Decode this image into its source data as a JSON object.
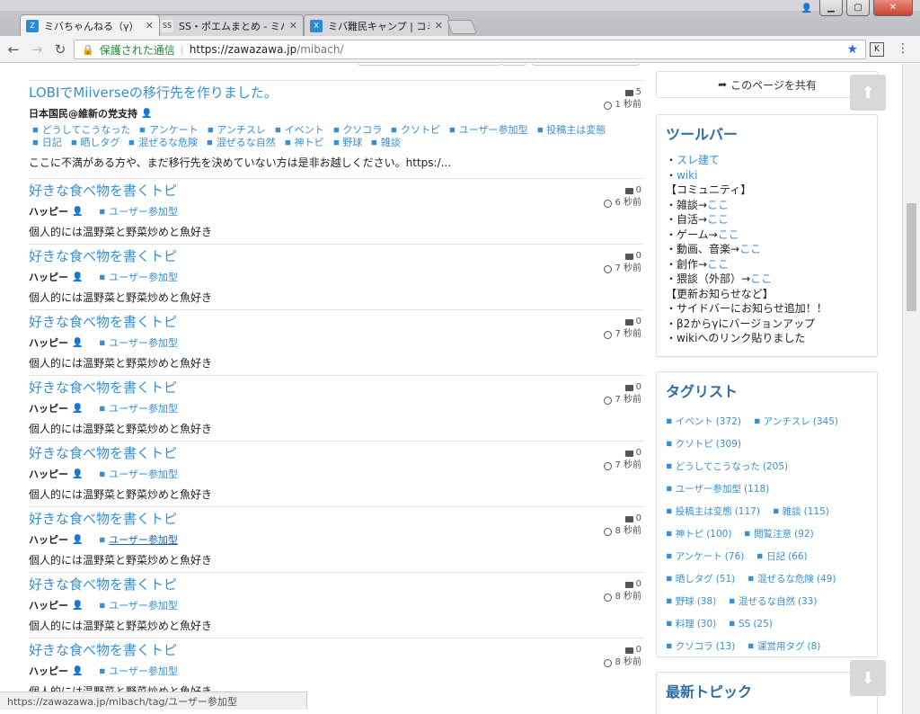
{
  "browser": {
    "tabs": [
      {
        "title": "ミバちゃんねる（γ） - ミ",
        "active": true,
        "favicon": "Z"
      },
      {
        "title": "SS・ポエムまとめ - ミバ",
        "active": false,
        "favicon": "SS"
      },
      {
        "title": "ミバ難民キャンプ | コミ",
        "active": false,
        "favicon": "X"
      }
    ],
    "secure_label": "保護された通信",
    "url_host": "https://zawazawa.jp",
    "url_path": "/mibach/",
    "ext_label": "K"
  },
  "main": {
    "topics": [
      {
        "title": "LOBIでMiiverseの移行先を作りました。",
        "author": "日本国民@維新の党支持",
        "tags": [
          "どうしてこうなった",
          "アンケート",
          "アンチスレ",
          "イベント",
          "クソコラ",
          "クソトピ",
          "ユーザー参加型",
          "投稿主は変態",
          "日記",
          "晒しタグ",
          "混ぜるな危険",
          "混ぜるな自然",
          "神トピ",
          "野球",
          "雑談"
        ],
        "excerpt": "ここに不満がある方や、まだ移行先を決めていない方は是非お越しください。https:/...",
        "comments": "5",
        "time": "1 秒前"
      },
      {
        "title": "好きな食べ物を書くトピ",
        "author": "ハッピー",
        "tags": [
          "ユーザー参加型"
        ],
        "excerpt": "個人的には温野菜と野菜炒めと魚好き",
        "comments": "0",
        "time": "6 秒前"
      },
      {
        "title": "好きな食べ物を書くトピ",
        "author": "ハッピー",
        "tags": [
          "ユーザー参加型"
        ],
        "excerpt": "個人的には温野菜と野菜炒めと魚好き",
        "comments": "0",
        "time": "7 秒前"
      },
      {
        "title": "好きな食べ物を書くトピ",
        "author": "ハッピー",
        "tags": [
          "ユーザー参加型"
        ],
        "excerpt": "個人的には温野菜と野菜炒めと魚好き",
        "comments": "0",
        "time": "7 秒前"
      },
      {
        "title": "好きな食べ物を書くトピ",
        "author": "ハッピー",
        "tags": [
          "ユーザー参加型"
        ],
        "excerpt": "個人的には温野菜と野菜炒めと魚好き",
        "comments": "0",
        "time": "7 秒前"
      },
      {
        "title": "好きな食べ物を書くトピ",
        "author": "ハッピー",
        "tags": [
          "ユーザー参加型"
        ],
        "excerpt": "個人的には温野菜と野菜炒めと魚好き",
        "comments": "0",
        "time": "7 秒前"
      },
      {
        "title": "好きな食べ物を書くトピ",
        "author": "ハッピー",
        "tags": [
          "ユーザー参加型"
        ],
        "excerpt": "個人的には温野菜と野菜炒めと魚好き",
        "comments": "0",
        "time": "8 秒前",
        "hover_tag": true
      },
      {
        "title": "好きな食べ物を書くトピ",
        "author": "ハッピー",
        "tags": [
          "ユーザー参加型"
        ],
        "excerpt": "個人的には温野菜と野菜炒めと魚好き",
        "comments": "0",
        "time": "8 秒前"
      },
      {
        "title": "好きな食べ物を書くトピ",
        "author": "ハッピー",
        "tags": [
          "ユーザー参加型"
        ],
        "excerpt": "個人的には温野菜と野菜炒めと魚好き",
        "comments": "0",
        "time": "8 秒前"
      }
    ],
    "status_url": "https://zawazawa.jp/mibach/tag/ユーザー参加型"
  },
  "sidebar": {
    "share_label": "このページを共有",
    "toolbar_title": "ツールバー",
    "toolbar_lines": [
      {
        "pre": "・",
        "link": "スレ建て",
        "post": ""
      },
      {
        "pre": "・",
        "link": "wiki",
        "post": ""
      },
      {
        "pre": "【コミュニティ】",
        "link": "",
        "post": ""
      },
      {
        "pre": "・雑談→",
        "link": "ここ",
        "post": ""
      },
      {
        "pre": "・自活→",
        "link": "ここ",
        "post": ""
      },
      {
        "pre": "・ゲーム→",
        "link": "ここ",
        "post": ""
      },
      {
        "pre": "・動画、音楽→",
        "link": "ここ",
        "post": ""
      },
      {
        "pre": "・創作→",
        "link": "ここ",
        "post": ""
      },
      {
        "pre": "・猥談（外部）→",
        "link": "ここ",
        "post": ""
      },
      {
        "pre": "【更新お知らせなど】",
        "link": "",
        "post": ""
      },
      {
        "pre": "・サイドバーにお知らせ追加！！",
        "link": "",
        "post": ""
      },
      {
        "pre": "・β2からγにバージョンアップ",
        "link": "",
        "post": ""
      },
      {
        "pre": "・wikiへのリンク貼りました",
        "link": "",
        "post": ""
      }
    ],
    "taglist_title": "タグリスト",
    "taglist_rows": [
      [
        {
          "name": "イベント",
          "count": "(372)"
        },
        {
          "name": "アンチスレ",
          "count": "(345)"
        }
      ],
      [
        {
          "name": "クソトピ",
          "count": "(309)"
        }
      ],
      [
        {
          "name": "どうしてこうなった",
          "count": "(205)"
        }
      ],
      [
        {
          "name": "ユーザー参加型",
          "count": "(118)"
        }
      ],
      [
        {
          "name": "投稿主は変態",
          "count": "(117)"
        },
        {
          "name": "雑談",
          "count": "(115)"
        }
      ],
      [
        {
          "name": "神トピ",
          "count": "(100)"
        },
        {
          "name": "閲覧注意",
          "count": "(92)"
        }
      ],
      [
        {
          "name": "アンケート",
          "count": "(76)"
        },
        {
          "name": "日記",
          "count": "(66)"
        }
      ],
      [
        {
          "name": "晒しタグ",
          "count": "(51)"
        },
        {
          "name": "混ぜるな危険",
          "count": "(49)"
        }
      ],
      [
        {
          "name": "野球",
          "count": "(38)"
        },
        {
          "name": "混ぜるな自然",
          "count": "(33)"
        }
      ],
      [
        {
          "name": "料理",
          "count": "(30)"
        },
        {
          "name": "SS",
          "count": "(25)"
        }
      ],
      [
        {
          "name": "クソコラ",
          "count": "(13)"
        },
        {
          "name": "運営用タグ",
          "count": "(8)"
        }
      ]
    ],
    "latest_title": "最新トピック"
  },
  "colors": {
    "link": "#3a8fd0",
    "heading": "#2c6ea6",
    "secure": "#1a8a3a"
  }
}
